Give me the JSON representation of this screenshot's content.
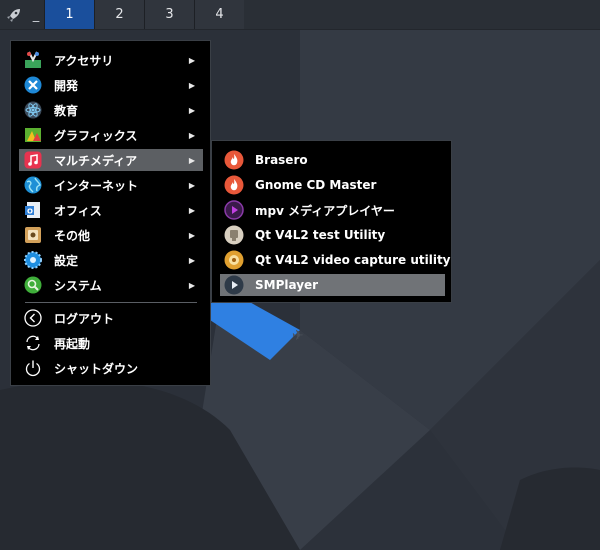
{
  "taskbar": {
    "launcher_icon": "rocket-icon",
    "dash": "_",
    "workspaces": [
      "1",
      "2",
      "3",
      "4"
    ]
  },
  "menu": {
    "categories": [
      {
        "label": "アクセサリ",
        "icon": "accessories-icon"
      },
      {
        "label": "開発",
        "icon": "development-icon"
      },
      {
        "label": "教育",
        "icon": "education-icon"
      },
      {
        "label": "グラフィックス",
        "icon": "graphics-icon"
      },
      {
        "label": "マルチメディア",
        "icon": "multimedia-icon"
      },
      {
        "label": "インターネット",
        "icon": "internet-icon"
      },
      {
        "label": "オフィス",
        "icon": "office-icon"
      },
      {
        "label": "その他",
        "icon": "other-icon"
      },
      {
        "label": "設定",
        "icon": "settings-icon"
      },
      {
        "label": "システム",
        "icon": "system-icon"
      }
    ],
    "session": [
      {
        "label": "ログアウト",
        "icon": "logout-icon"
      },
      {
        "label": "再起動",
        "icon": "reboot-icon"
      },
      {
        "label": "シャットダウン",
        "icon": "shutdown-icon"
      }
    ],
    "submenu_arrow": "▶"
  },
  "submenu": {
    "items": [
      {
        "label": "Brasero",
        "icon": "brasero-icon"
      },
      {
        "label": "Gnome CD Master",
        "icon": "gnome-cd-master-icon"
      },
      {
        "label": "mpv メディアプレイヤー",
        "icon": "mpv-icon"
      },
      {
        "label": "Qt V4L2 test Utility",
        "icon": "qv4l2-icon"
      },
      {
        "label": "Qt V4L2 video capture utility",
        "icon": "qvidcap-icon"
      },
      {
        "label": "SMPlayer",
        "icon": "smplayer-icon"
      }
    ]
  },
  "colors": {
    "taskbar": "#2a2f36",
    "workspace_active": "#1a4f9c",
    "menu_bg": "#000000",
    "highlight": "#5c5f63",
    "wallpaper_blue": "#2f80e2"
  }
}
